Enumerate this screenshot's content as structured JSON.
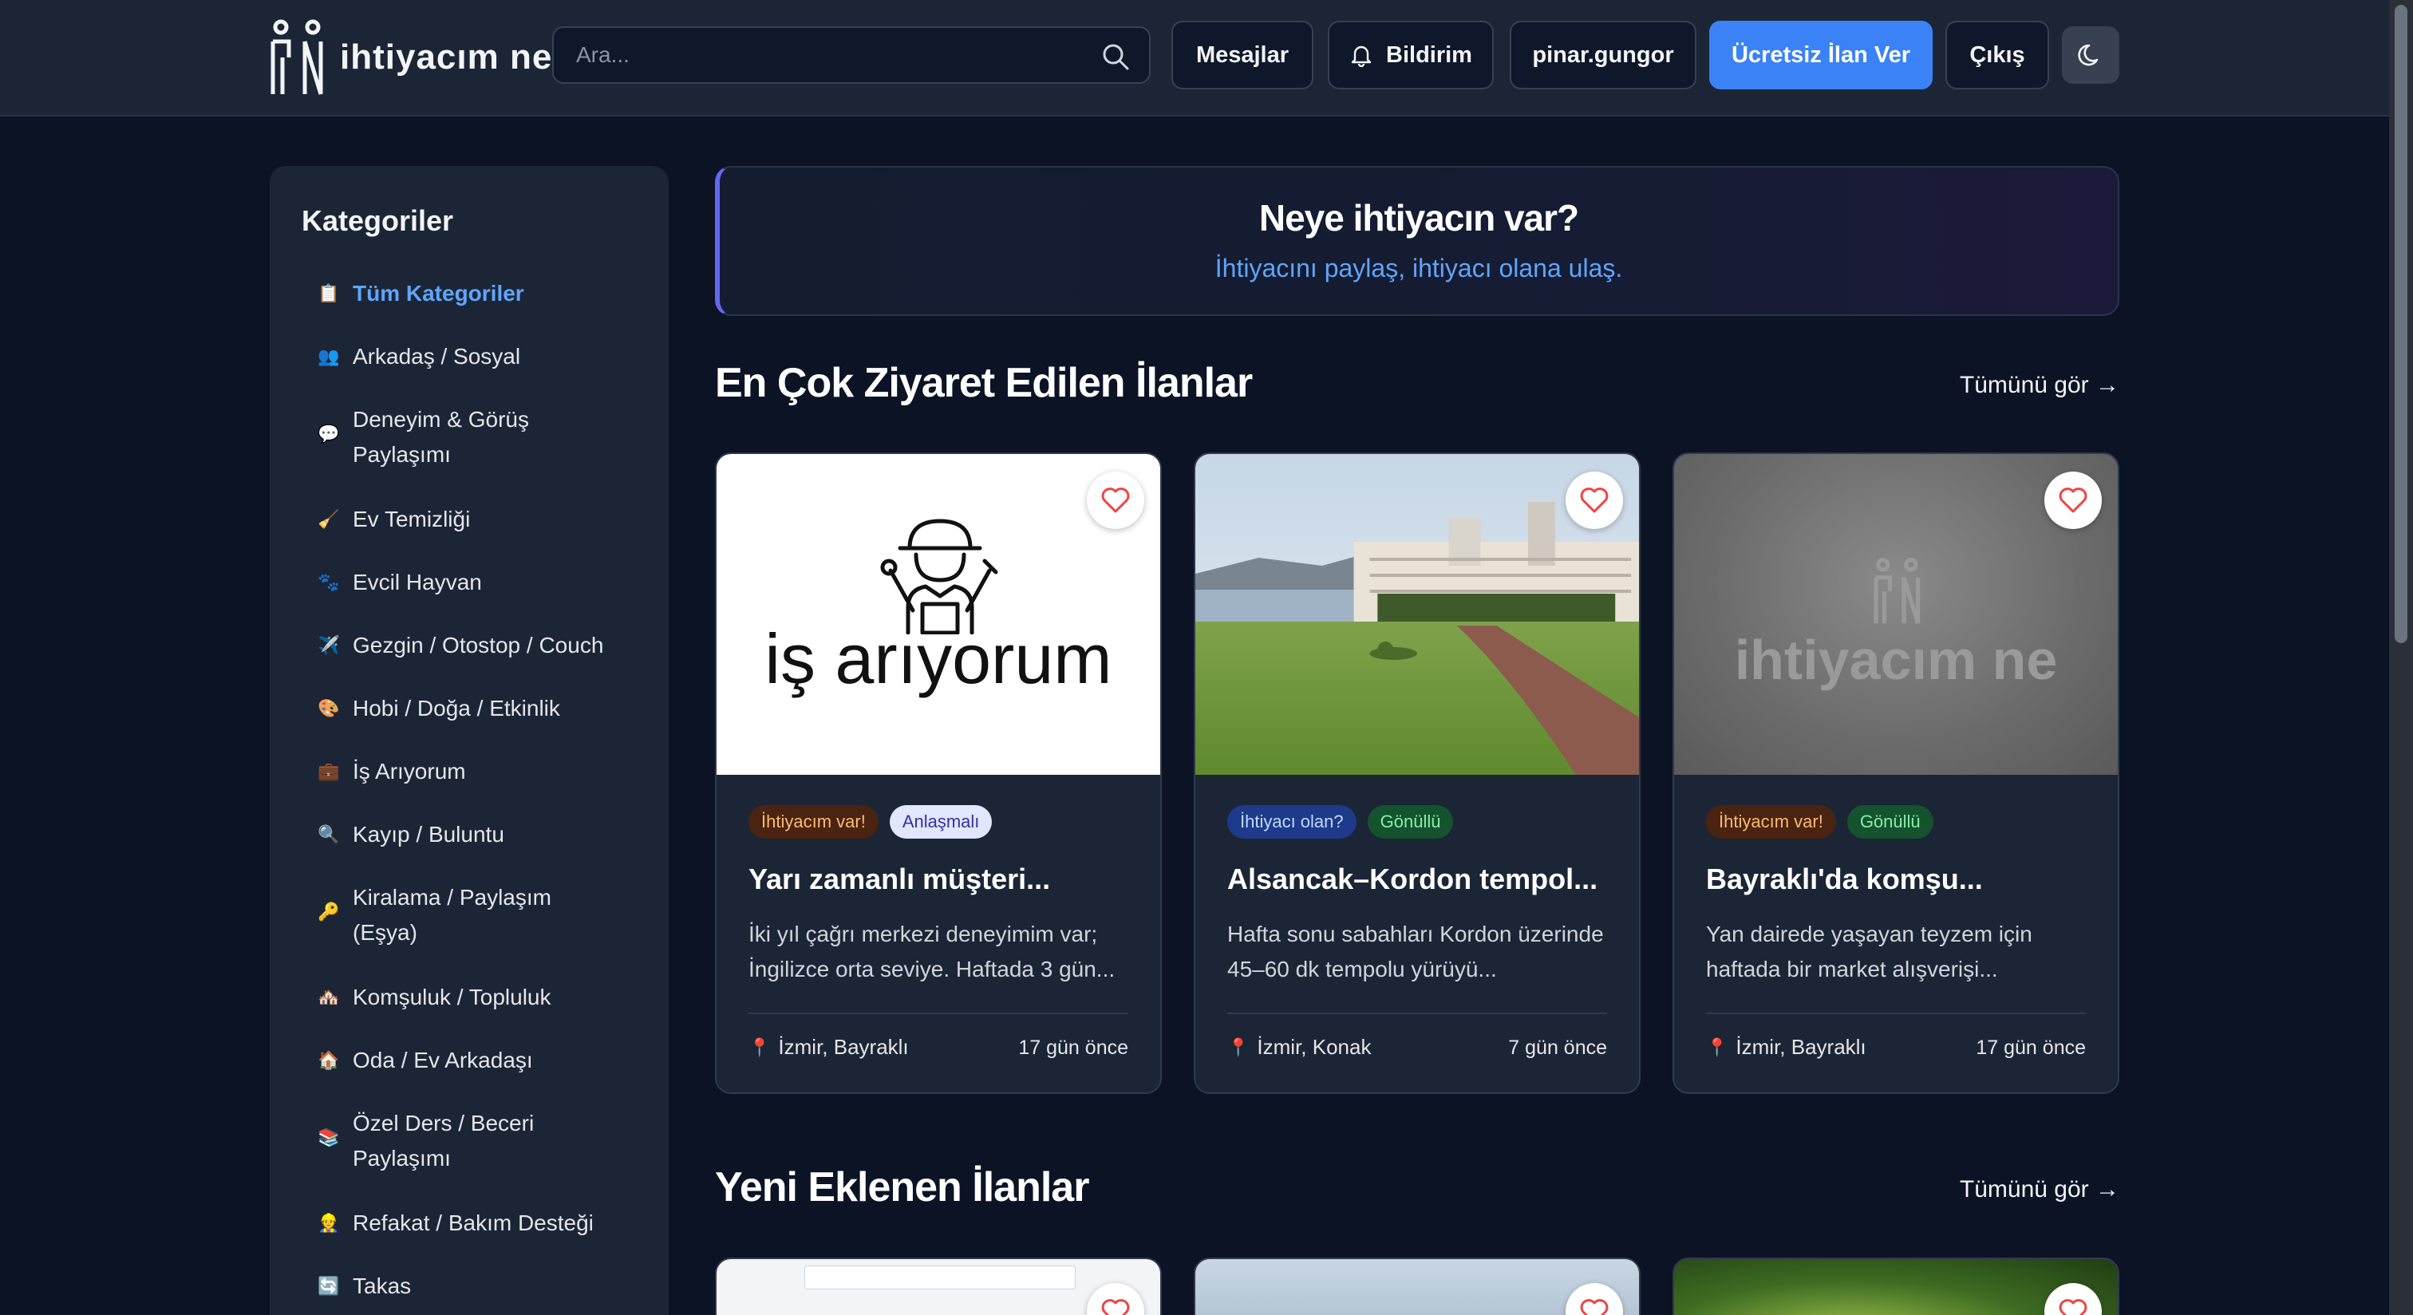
{
  "header": {
    "logo_text": "ihtiyacım ne",
    "search_placeholder": "Ara...",
    "messages": "Mesajlar",
    "notifications": "Bildirim",
    "username": "pinar.gungor",
    "post_free": "Ücretsiz İlan Ver",
    "logout": "Çıkış"
  },
  "sidebar": {
    "title": "Kategoriler",
    "items": [
      {
        "emoji": "📋",
        "label": "Tüm Kategoriler",
        "active": true
      },
      {
        "emoji": "👥",
        "label": "Arkadaş / Sosyal"
      },
      {
        "emoji": "💬",
        "label": "Deneyim & Görüş Paylaşımı"
      },
      {
        "emoji": "🧹",
        "label": "Ev Temizliği"
      },
      {
        "emoji": "🐾",
        "label": "Evcil Hayvan"
      },
      {
        "emoji": "✈️",
        "label": "Gezgin / Otostop / Couch"
      },
      {
        "emoji": "🎨",
        "label": "Hobi / Doğa / Etkinlik"
      },
      {
        "emoji": "💼",
        "label": "İş Arıyorum"
      },
      {
        "emoji": "🔍",
        "label": "Kayıp / Buluntu"
      },
      {
        "emoji": "🔑",
        "label": "Kiralama / Paylaşım (Eşya)"
      },
      {
        "emoji": "🏘️",
        "label": "Komşuluk / Topluluk"
      },
      {
        "emoji": "🏠",
        "label": "Oda / Ev Arkadaşı"
      },
      {
        "emoji": "📚",
        "label": "Özel Ders / Beceri Paylaşımı"
      },
      {
        "emoji": "👷",
        "label": "Refakat / Bakım Desteği"
      },
      {
        "emoji": "🔄",
        "label": "Takas"
      }
    ]
  },
  "hero": {
    "title": "Neye ihtiyacın var?",
    "subtitle": "İhtiyacını paylaş, ihtiyacı olana ulaş."
  },
  "popular": {
    "title": "En Çok Ziyaret Edilen İlanlar",
    "see_all": "Tümünü gör →",
    "cards": [
      {
        "image_text": "iş arıyorum",
        "badges": [
          {
            "text": "İhtiyacım var!",
            "kind": "need"
          },
          {
            "text": "Anlaşmalı",
            "kind": "agree"
          }
        ],
        "title": "Yarı zamanlı müşteri...",
        "desc": "İki yıl çağrı merkezi deneyimim var; İngilizce orta seviye. Haftada 3 gün...",
        "location": "İzmir, Bayraklı",
        "time": "17 gün önce"
      },
      {
        "badges": [
          {
            "text": "İhtiyacı olan?",
            "kind": "who"
          },
          {
            "text": "Gönüllü",
            "kind": "vol"
          }
        ],
        "title": "Alsancak–Kordon tempol...",
        "desc": "Hafta sonu sabahları Kordon üzerinde 45–60 dk tempolu yürüyü...",
        "location": "İzmir, Konak",
        "time": "7 gün önce"
      },
      {
        "image_text": "ihtiyacım ne",
        "badges": [
          {
            "text": "İhtiyacım var!",
            "kind": "need"
          },
          {
            "text": "Gönüllü",
            "kind": "vol"
          }
        ],
        "title": "Bayraklı'da komşu...",
        "desc": "Yan dairede yaşayan teyzem için haftada bir market alışverişi...",
        "location": "İzmir, Bayraklı",
        "time": "17 gün önce"
      }
    ]
  },
  "recent": {
    "title": "Yeni Eklenen İlanlar",
    "see_all": "Tümünü gör →"
  },
  "colors": {
    "accent": "#3b82f6",
    "link": "#60a5fa",
    "background": "#0b1325",
    "panel": "#1b2536"
  }
}
